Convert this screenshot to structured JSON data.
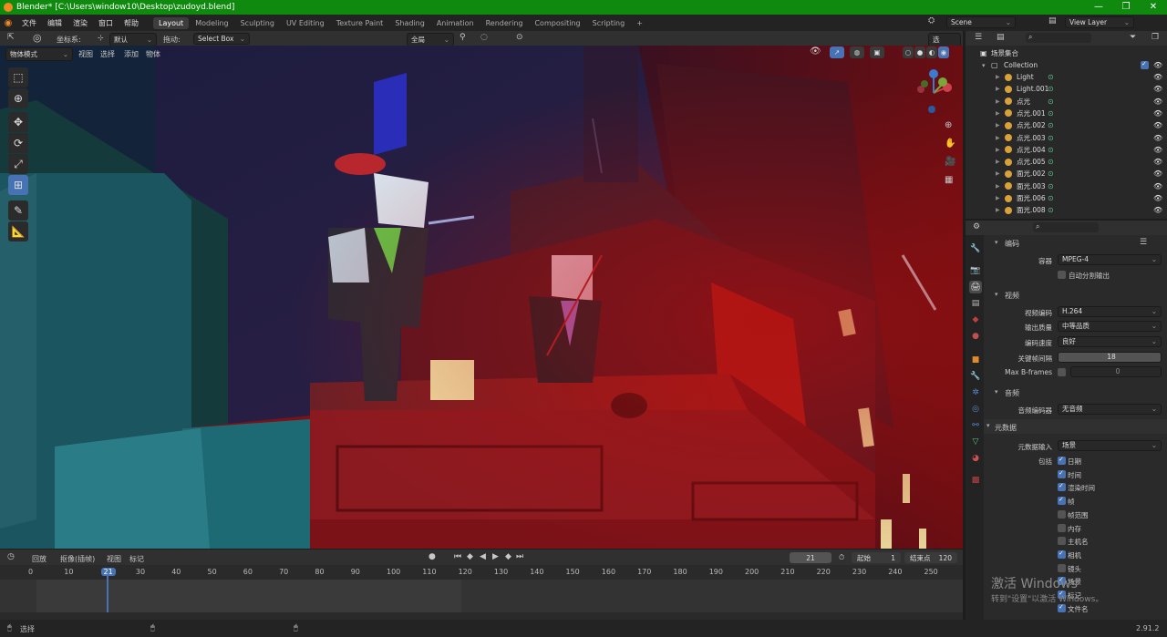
{
  "title": "Blender* [C:\\Users\\window10\\Desktop\\zudoyd.blend]",
  "menu": [
    "文件",
    "编辑",
    "渲染",
    "窗口",
    "帮助"
  ],
  "workspaces": [
    "Layout",
    "Modeling",
    "Sculpting",
    "UV Editing",
    "Texture Paint",
    "Shading",
    "Animation",
    "Rendering",
    "Compositing",
    "Scripting"
  ],
  "scene": {
    "name": "Scene",
    "view_layer": "View Layer"
  },
  "toolbar": {
    "coord_label": "坐标系:",
    "coord_value": "默认",
    "drag_label": "拖动:",
    "drag_value": "Select Box",
    "pivot": "全局",
    "options": "选项"
  },
  "viewport_header": {
    "mode": "物体模式",
    "items": [
      "视图",
      "选择",
      "添加",
      "物体"
    ]
  },
  "outliner": {
    "root": "场景集合",
    "collection": "Collection",
    "items": [
      "Light",
      "Light.001",
      "点光",
      "点光.001",
      "点光.002",
      "点光.003",
      "点光.004",
      "点光.005",
      "面光.002",
      "面光.003",
      "面光.006",
      "面光.008"
    ]
  },
  "properties": {
    "encoding_section": "编码",
    "container_label": "容器",
    "container_value": "MPEG-4",
    "autosplit": "自动分割输出",
    "video_section": "视频",
    "codec_label": "视频编码",
    "codec_value": "H.264",
    "quality_label": "输出质量",
    "quality_value": "中等品质",
    "speed_label": "编码速度",
    "speed_value": "良好",
    "keyframe_label": "关键帧间隔",
    "keyframe_value": "18",
    "bframes_label": "Max B-frames",
    "bframes_value": "0",
    "audio_section": "音频",
    "audio_codec_label": "音频编码器",
    "audio_codec_value": "无音频",
    "metadata_section": "元数据",
    "metadata_input_label": "元数据输入",
    "metadata_input_value": "场景",
    "include_label": "包括",
    "checks": [
      {
        "label": "日期",
        "on": true
      },
      {
        "label": "时间",
        "on": true
      },
      {
        "label": "渲染时间",
        "on": true
      },
      {
        "label": "帧",
        "on": true
      },
      {
        "label": "帧范围",
        "on": false
      },
      {
        "label": "内存",
        "on": false
      },
      {
        "label": "主机名",
        "on": false
      },
      {
        "label": "相机",
        "on": true
      },
      {
        "label": "镜头",
        "on": false
      },
      {
        "label": "场景",
        "on": true
      },
      {
        "label": "标记",
        "on": true
      },
      {
        "label": "文件名",
        "on": true
      }
    ]
  },
  "timeline": {
    "menu": [
      "回放",
      "抠像(插帧)",
      "视图",
      "标记"
    ],
    "current_frame": "21",
    "start_label": "起始",
    "start": "1",
    "end_label": "结束点",
    "end": "120",
    "ticks": [
      "0",
      "10",
      "21",
      "30",
      "40",
      "50",
      "60",
      "70",
      "80",
      "90",
      "100",
      "110",
      "120",
      "130",
      "140",
      "150",
      "160",
      "170",
      "180",
      "190",
      "200",
      "210",
      "220",
      "230",
      "240",
      "250"
    ]
  },
  "status": {
    "left": "选择",
    "version": "2.91.2"
  },
  "watermark": {
    "line1": "激活 Windows",
    "line2": "转到\"设置\"以激活 Windows。"
  }
}
